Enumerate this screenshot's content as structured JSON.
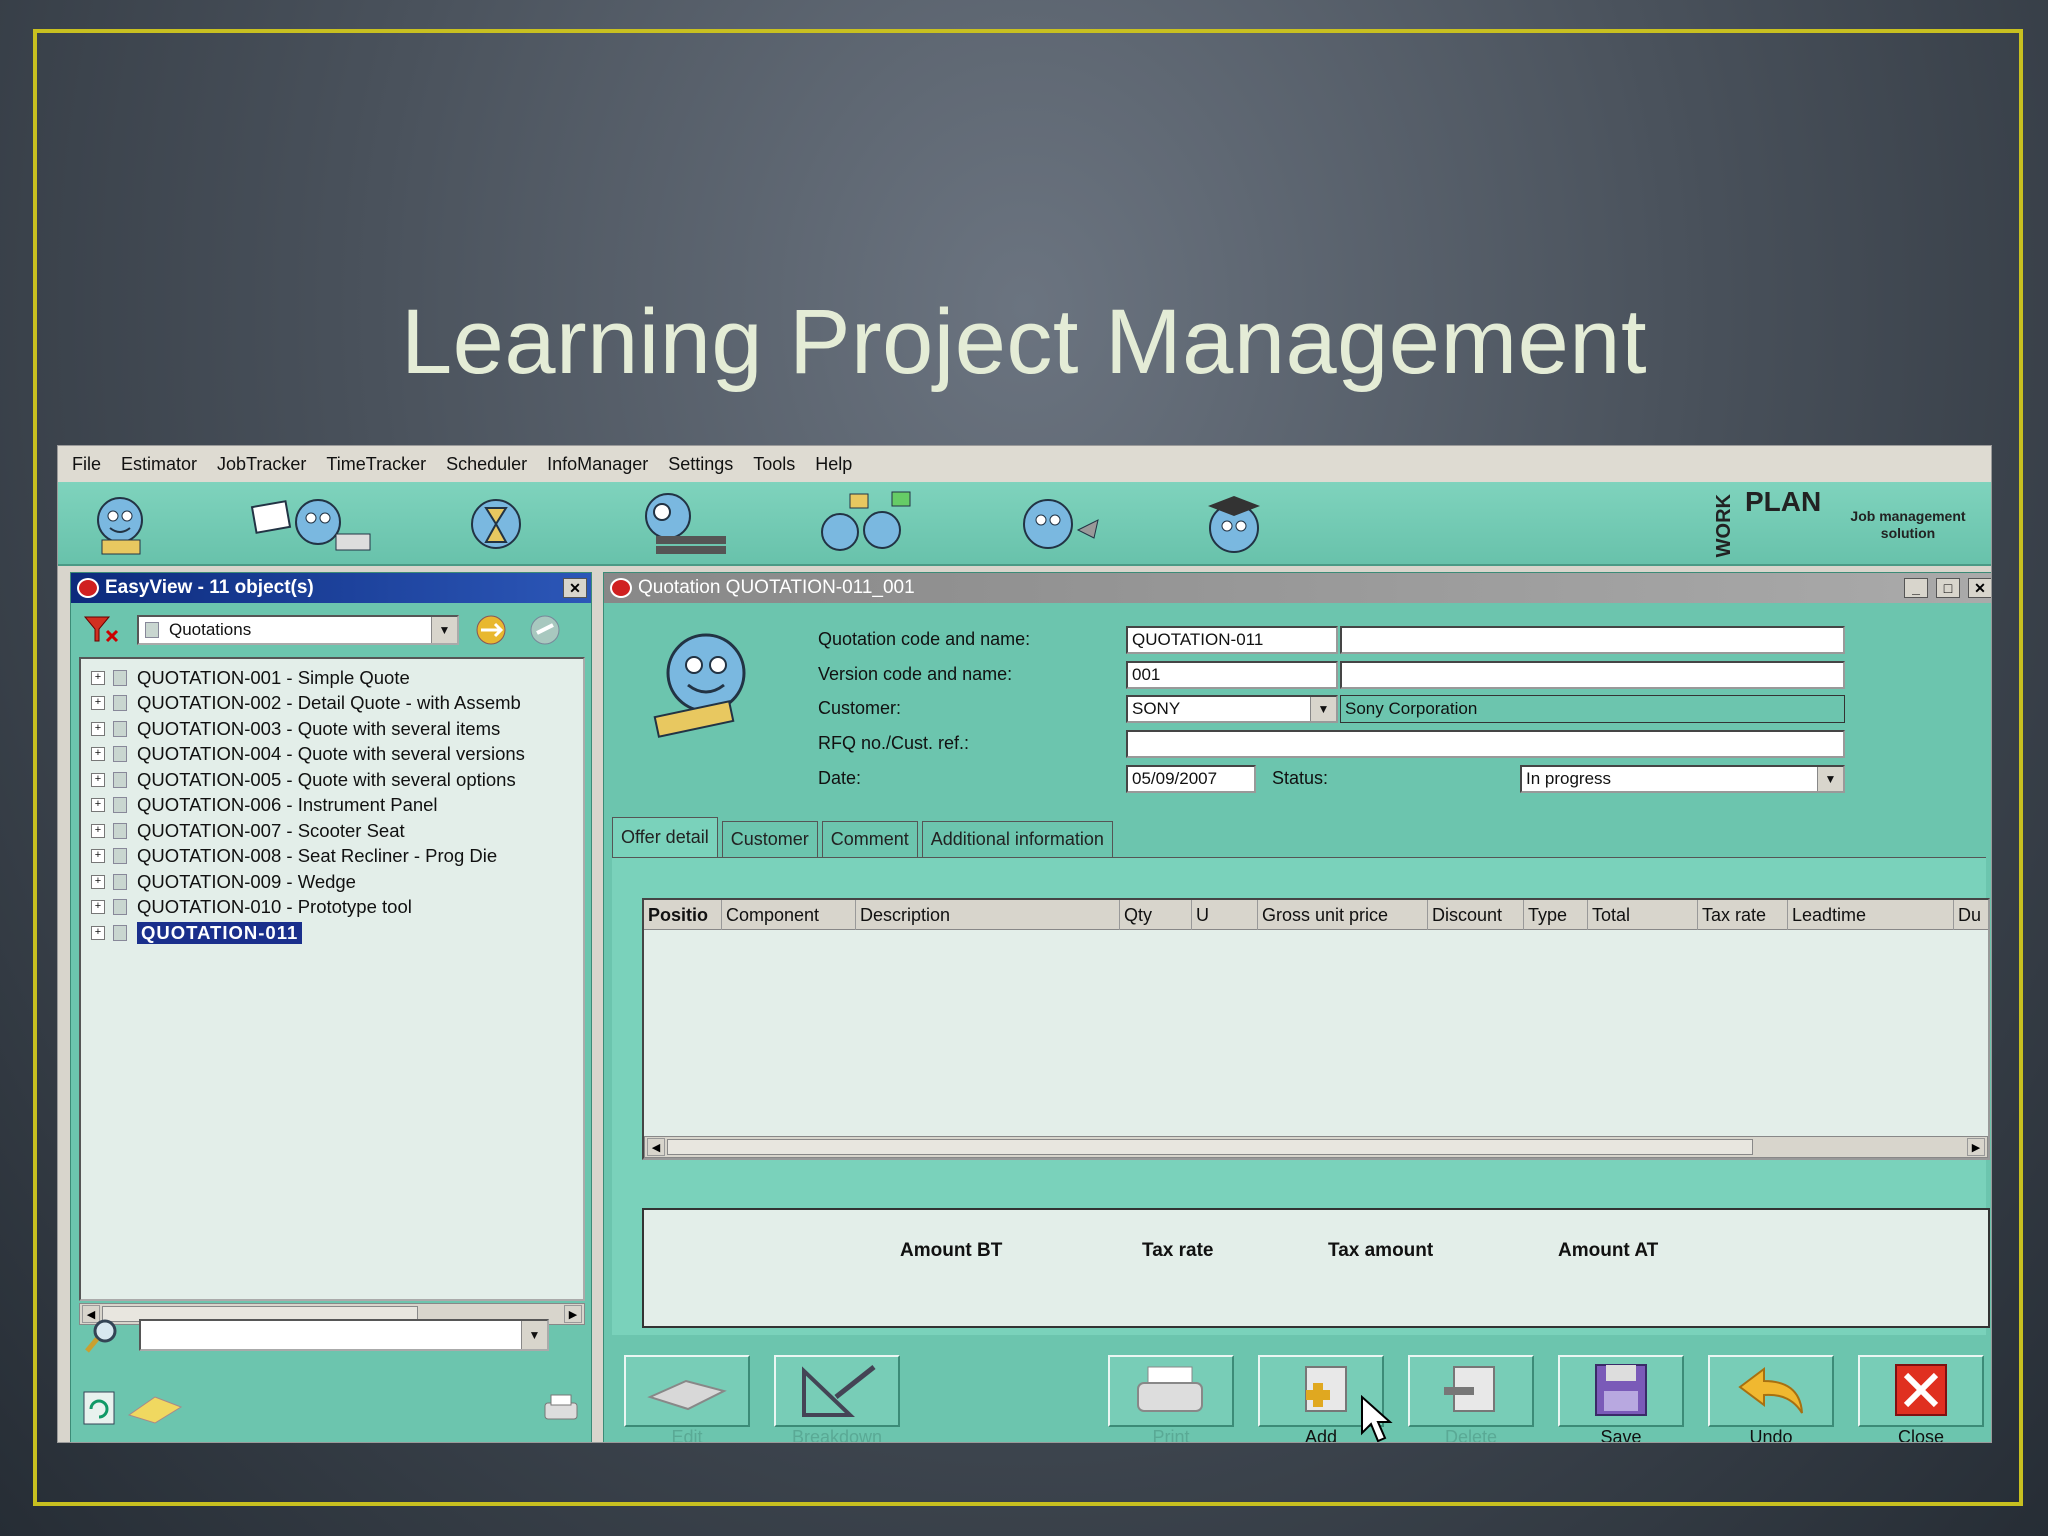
{
  "slide": {
    "title": "Learning Project Management"
  },
  "menubar": {
    "items": [
      "File",
      "Estimator",
      "JobTracker",
      "TimeTracker",
      "Scheduler",
      "InfoManager",
      "Settings",
      "Tools",
      "Help"
    ]
  },
  "brand": {
    "plan": "PLAN",
    "w": "WORK",
    "tagline": "Job management solution"
  },
  "easyview": {
    "title": "EasyView - 11 object(s)",
    "filter_value": "Quotations",
    "items": [
      "QUOTATION-001 - Simple Quote",
      "QUOTATION-002 - Detail Quote - with Assemb",
      "QUOTATION-003 - Quote with several items",
      "QUOTATION-004 - Quote with several versions",
      "QUOTATION-005 - Quote with several options",
      "QUOTATION-006 - Instrument Panel",
      "QUOTATION-007 - Scooter Seat",
      "QUOTATION-008 - Seat Recliner - Prog Die",
      "QUOTATION-009 - Wedge",
      "QUOTATION-010 - Prototype tool",
      "QUOTATION-011"
    ],
    "selected_index": 10,
    "search_value": ""
  },
  "quotation": {
    "title": "Quotation QUOTATION-011_001",
    "labels": {
      "code_name": "Quotation code and name:",
      "version": "Version code and name:",
      "customer": "Customer:",
      "rfq": "RFQ no./Cust. ref.:",
      "date": "Date:",
      "status": "Status:"
    },
    "values": {
      "code": "QUOTATION-011",
      "name": "",
      "version_code": "001",
      "version_name": "",
      "customer_code": "SONY",
      "customer_name": "Sony Corporation",
      "rfq": "",
      "date": "05/09/2007",
      "status": "In progress"
    },
    "tabs": [
      "Offer detail",
      "Customer",
      "Comment",
      "Additional information"
    ],
    "active_tab": 0,
    "grid_columns": [
      "Positio",
      "Component",
      "Description",
      "Qty",
      "U",
      "Gross unit price",
      "Discount",
      "Type",
      "Total",
      "Tax rate",
      "Leadtime",
      "Du"
    ],
    "totals_headers": [
      "Amount BT",
      "Tax rate",
      "Tax amount",
      "Amount AT"
    ],
    "actions": [
      {
        "label": "Edit",
        "enabled": false
      },
      {
        "label": "Breakdown",
        "enabled": false
      },
      {
        "label": "Print",
        "enabled": false
      },
      {
        "label": "Add",
        "enabled": true
      },
      {
        "label": "Delete",
        "enabled": false
      },
      {
        "label": "Save",
        "enabled": true
      },
      {
        "label": "Undo",
        "enabled": true
      },
      {
        "label": "Close",
        "enabled": true
      }
    ]
  },
  "colors": {
    "app_teal": "#6cc5ae",
    "title_blue": "#0c2a7c",
    "frame_yellow": "#c8c020"
  }
}
